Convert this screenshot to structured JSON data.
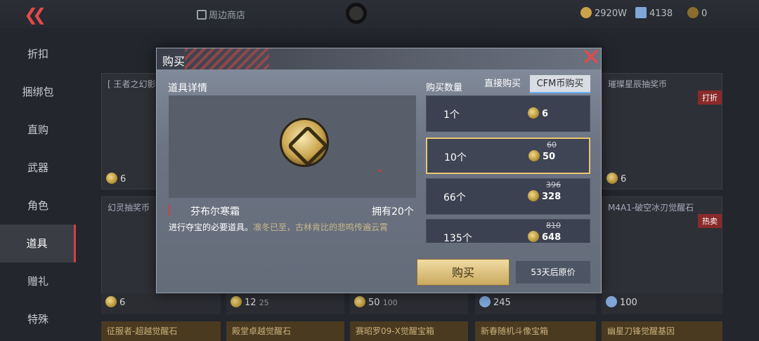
{
  "top": {
    "shop_label": "周边商店",
    "currency1": "2920W",
    "currency2": "4138",
    "currency3": "0"
  },
  "sidebar": {
    "items": [
      {
        "label": "折扣"
      },
      {
        "label": "捆绑包"
      },
      {
        "label": "直购"
      },
      {
        "label": "武器"
      },
      {
        "label": "角色"
      },
      {
        "label": "道具"
      },
      {
        "label": "赠礼"
      },
      {
        "label": "特殊"
      }
    ]
  },
  "background_cards": [
    {
      "title": "[ 王者之幻影..",
      "price": "6"
    },
    {
      "title": "幻灵抽奖币",
      "price": "6"
    },
    {
      "title": "璀璨星辰抽奖币",
      "price": "6",
      "tag": "打折"
    },
    {
      "title": "M4A1-破空冰刃觉醒石",
      "price": "",
      "tag": "热卖"
    }
  ],
  "bottom_prices": [
    {
      "price": "6"
    },
    {
      "price": "12",
      "sub": "25"
    },
    {
      "price": "50",
      "sub": "100"
    },
    {
      "price": "245"
    },
    {
      "price": "100"
    }
  ],
  "bottom_labels": [
    "征服者-超越觉醒石",
    "殿堂卓越觉醒石",
    "赛昭罗09-X觉醒宝箱",
    "新春随机斗像宝箱",
    "幽星刀锋觉醒基因"
  ],
  "modal": {
    "title": "购买",
    "details_title": "道具详情",
    "item_name": "芬布尔寒霜",
    "owned": "拥有20个",
    "desc_main": "进行夺宝的必要道具。",
    "desc_flavor": "凛冬已至，古林肯比的悲鸣传遍云霄",
    "qty_label": "购买数量",
    "tabs": [
      "直接购买",
      "CFM币购买"
    ],
    "options": [
      {
        "qty": "1个",
        "price": "6",
        "old": ""
      },
      {
        "qty": "10个",
        "price": "50",
        "old": "60"
      },
      {
        "qty": "66个",
        "price": "328",
        "old": "396"
      },
      {
        "qty": "135个",
        "price": "648",
        "old": "810"
      }
    ],
    "buy_label": "购买",
    "timer_label": "53天后原价"
  }
}
